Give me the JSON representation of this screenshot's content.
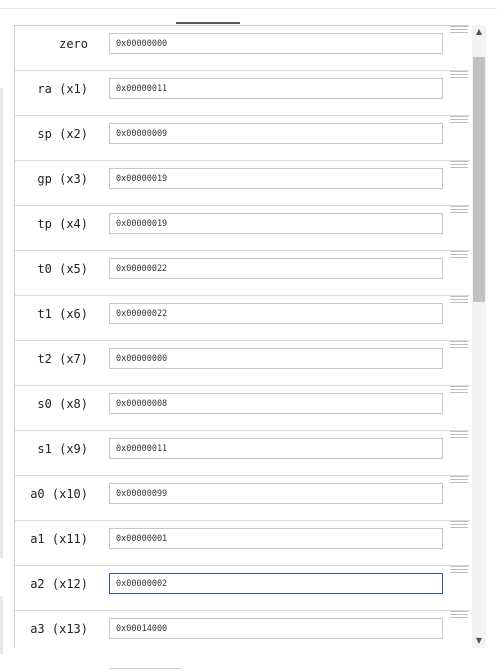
{
  "registers": [
    {
      "label": "zero",
      "value": "0x00000000"
    },
    {
      "label": "ra (x1)",
      "value": "0x00000011"
    },
    {
      "label": "sp (x2)",
      "value": "0x00000009"
    },
    {
      "label": "gp (x3)",
      "value": "0x00000019"
    },
    {
      "label": "tp (x4)",
      "value": "0x00000019"
    },
    {
      "label": "t0 (x5)",
      "value": "0x00000022"
    },
    {
      "label": "t1 (x6)",
      "value": "0x00000022"
    },
    {
      "label": "t2 (x7)",
      "value": "0x00000000"
    },
    {
      "label": "s0 (x8)",
      "value": "0x00000008"
    },
    {
      "label": "s1 (x9)",
      "value": "0x00000011"
    },
    {
      "label": "a0 (x10)",
      "value": "0x00000099"
    },
    {
      "label": "a1 (x11)",
      "value": "0x00000001"
    },
    {
      "label": "a2 (x12)",
      "value": "0x00000002"
    },
    {
      "label": "a3 (x13)",
      "value": "0x00014000"
    }
  ],
  "focused_register": "a2 (x12)",
  "scrollbar": {
    "up_arrow": "▲",
    "down_arrow": "▼"
  },
  "colors": {
    "focus_border": "#2a5db0",
    "row_divider": "#d9d9d9",
    "thumb": "#c1c1c1"
  }
}
